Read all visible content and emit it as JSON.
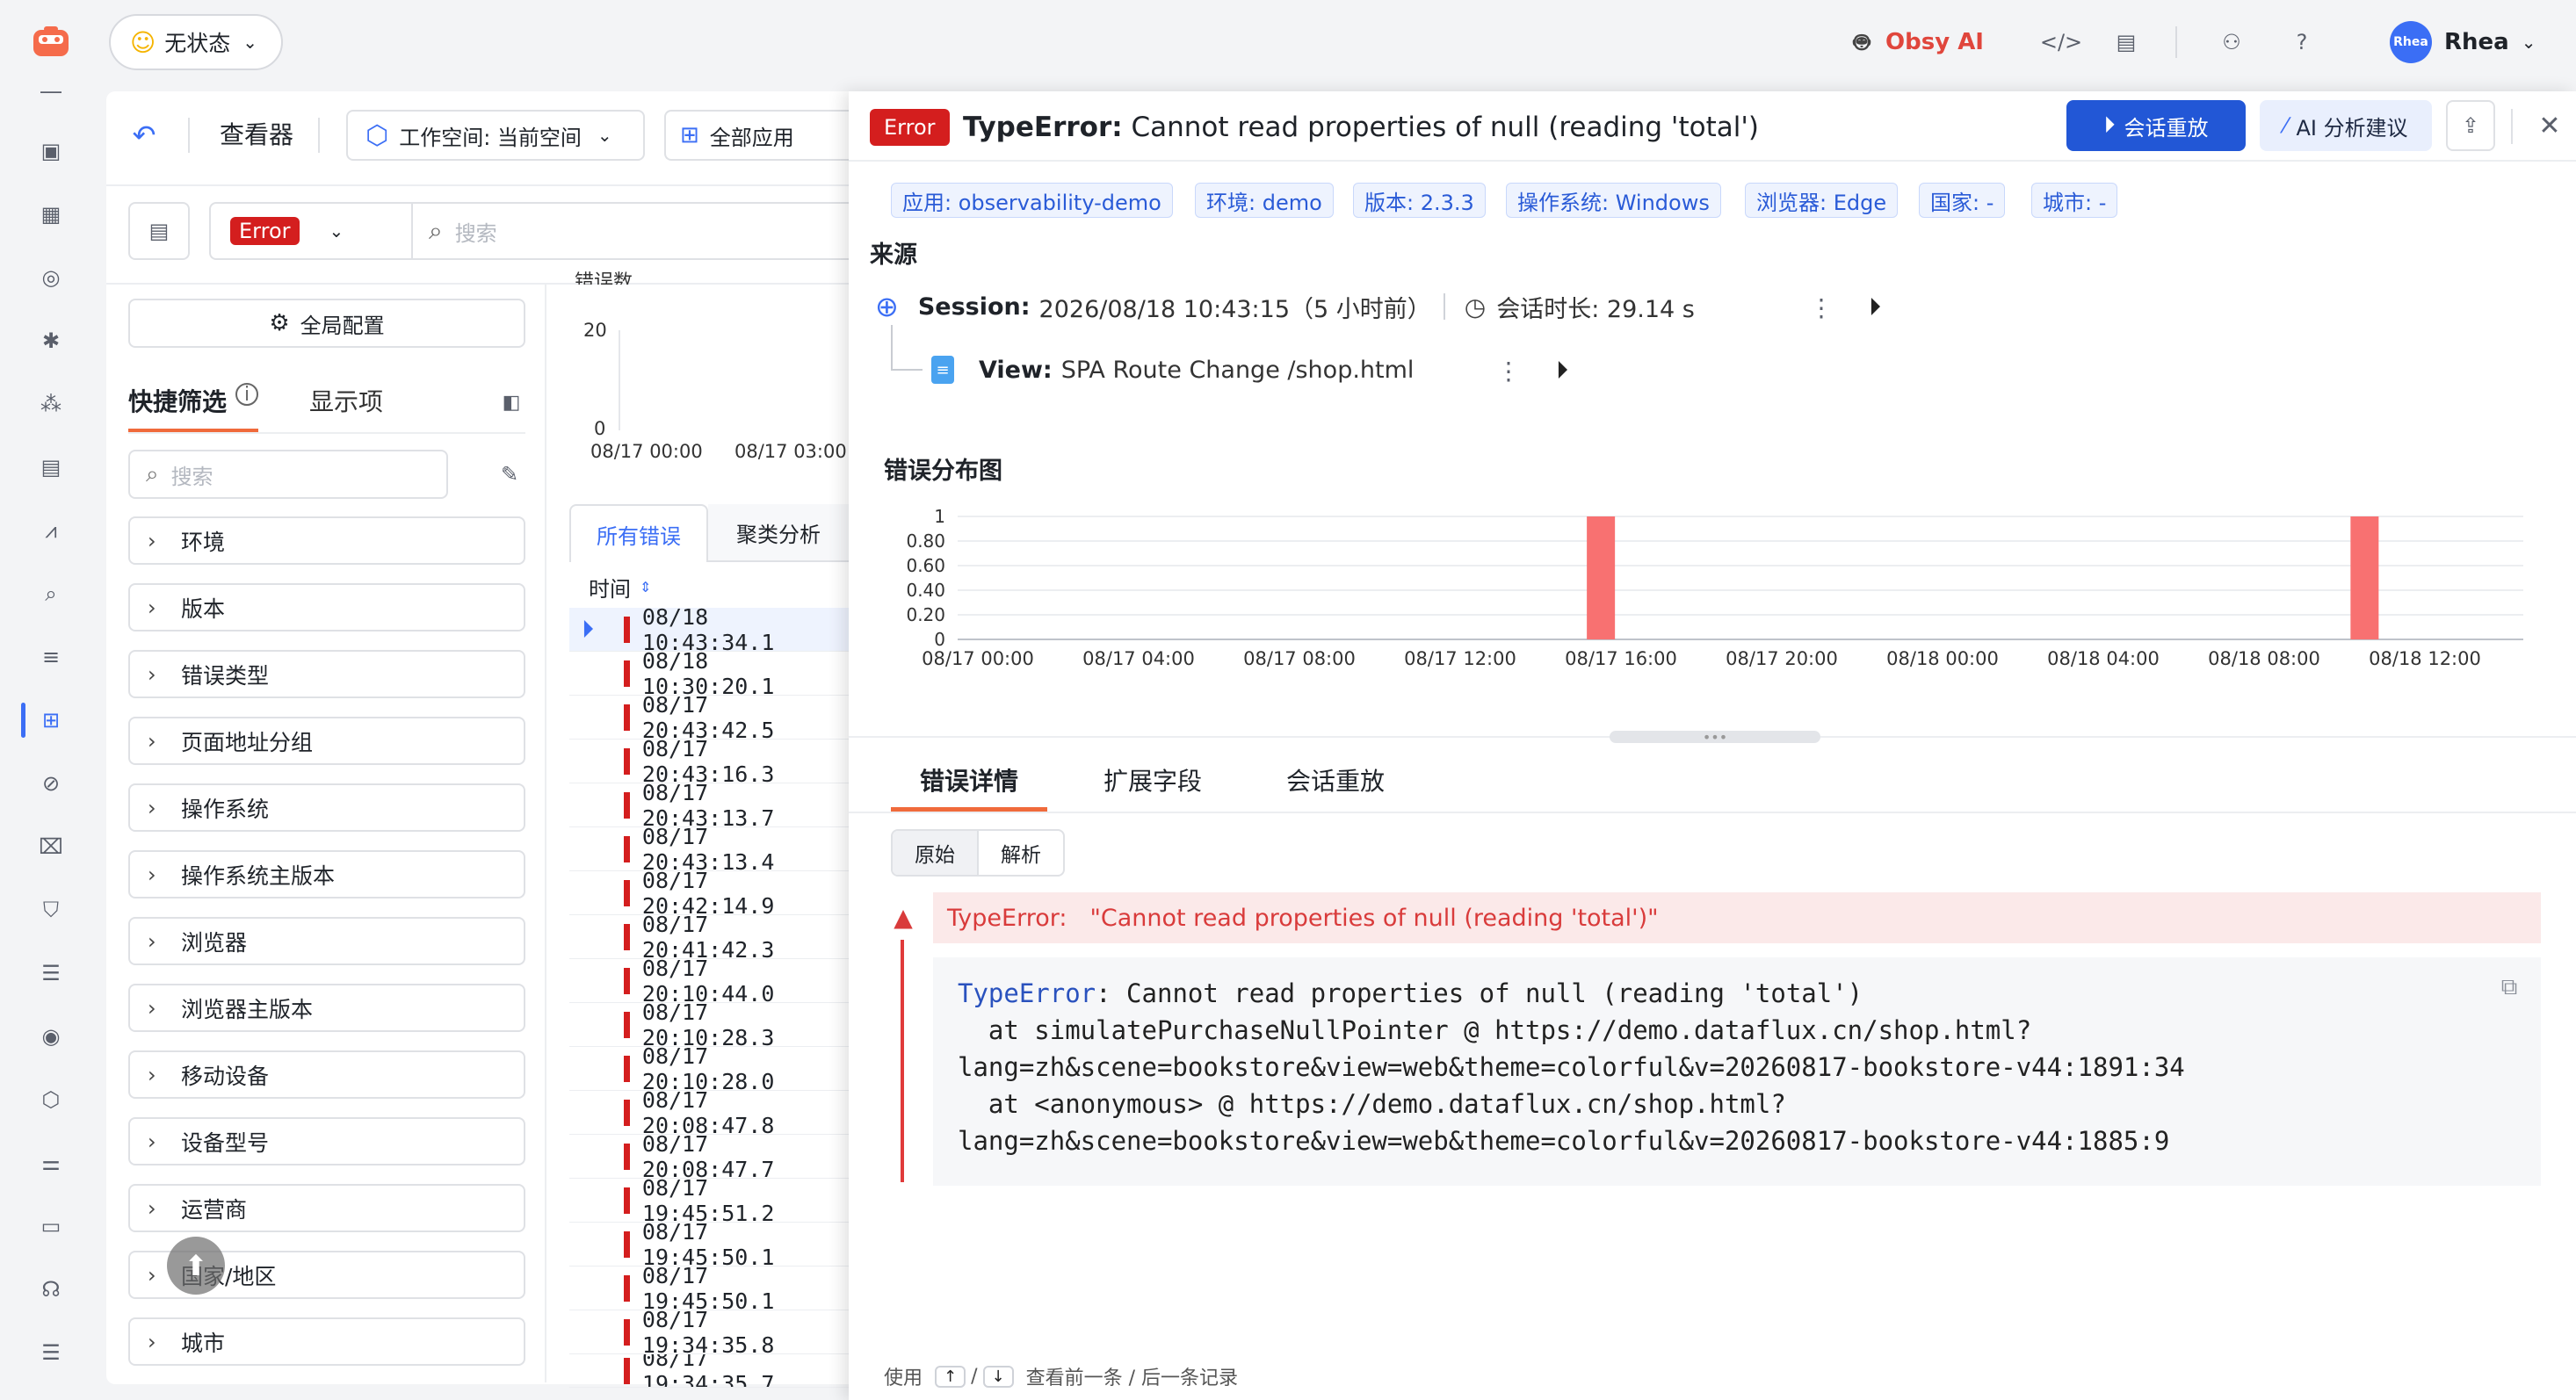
{
  "app": {
    "status_label": "无状态",
    "obsy_ai": "Obsy AI",
    "user_name": "Rhea",
    "avatar_text": "Rhea"
  },
  "toolbar": {
    "viewer_title": "查看器",
    "workspace_label": "工作空间: 当前空间",
    "apps_label": "全部应用",
    "filter_value": "Error",
    "search_placeholder": "搜索"
  },
  "sidebar": {
    "global_config": "全局配置",
    "tab_quick_filter": "快捷筛选",
    "tab_display": "显示项",
    "search_placeholder": "搜索",
    "filters": [
      "环境",
      "版本",
      "错误类型",
      "页面地址分组",
      "操作系统",
      "操作系统主版本",
      "浏览器",
      "浏览器主版本",
      "移动设备",
      "设备型号",
      "运营商",
      "国家/地区",
      "城市"
    ]
  },
  "mini_chart": {
    "y_top": "20",
    "y_bottom": "0",
    "x_ticks": [
      "08/17 00:00",
      "08/17 03:00"
    ],
    "header_partial": "错误数"
  },
  "list": {
    "tab_all": "所有错误",
    "tab_cluster": "聚类分析",
    "col_time": "时间",
    "rows": [
      "08/18 10:43:34.1",
      "08/18 10:30:20.1",
      "08/17 20:43:42.5",
      "08/17 20:43:16.3",
      "08/17 20:43:13.7",
      "08/17 20:43:13.4",
      "08/17 20:42:14.9",
      "08/17 20:41:42.3",
      "08/17 20:10:44.0",
      "08/17 20:10:28.3",
      "08/17 20:10:28.0",
      "08/17 20:08:47.8",
      "08/17 20:08:47.7",
      "08/17 19:45:51.2",
      "08/17 19:45:50.1",
      "08/17 19:45:50.1",
      "08/17 19:34:35.8",
      "08/17 19:34:35.7"
    ]
  },
  "detail": {
    "badge": "Error",
    "title_type": "TypeError:",
    "title_msg": "Cannot read properties of null (reading 'total')",
    "btn_replay": "会话重放",
    "btn_ai": "AI 分析建议",
    "tags": [
      "应用: observability-demo",
      "环境: demo",
      "版本: 2.3.3",
      "操作系统: Windows",
      "浏览器: Edge",
      "国家: -",
      "城市: -"
    ],
    "source_title": "来源",
    "session_label": "Session:",
    "session_value": "2026/08/18 10:43:15（5 小时前）",
    "duration_label": "会话时长: 29.14 s",
    "view_label": "View:",
    "view_value": "SPA Route Change /shop.html",
    "dist_title": "错误分布图",
    "tab_detail": "错误详情",
    "tab_ext": "扩展字段",
    "tab_replay": "会话重放",
    "seg_raw": "原始",
    "seg_parse": "解析",
    "err_type": "TypeError:",
    "err_msg": "\"Cannot read properties of null (reading 'total')\"",
    "stack": [
      "TypeError: Cannot read properties of null (reading 'total')",
      "  at simulatePurchaseNullPointer @ https://demo.dataflux.cn/shop.html?",
      "lang=zh&scene=bookstore&view=web&theme=colorful&v=20260817-bookstore-v44:1891:34",
      "  at <anonymous> @ https://demo.dataflux.cn/shop.html?",
      "lang=zh&scene=bookstore&view=web&theme=colorful&v=20260817-bookstore-v44:1885:9"
    ],
    "footer_use": "使用",
    "footer_up": "↑",
    "footer_sep": "/",
    "footer_down": "↓",
    "footer_hint": "查看前一条 / 后一条记录"
  },
  "chart_data": {
    "type": "bar",
    "title": "错误分布图",
    "x_ticks": [
      "08/17 00:00",
      "08/17 04:00",
      "08/17 08:00",
      "08/17 12:00",
      "08/17 16:00",
      "08/17 20:00",
      "08/18 00:00",
      "08/18 04:00",
      "08/18 08:00",
      "08/18 12:00"
    ],
    "y_ticks": [
      "1",
      "0.80",
      "0.60",
      "0.40",
      "0.20",
      "0"
    ],
    "ylim": [
      0,
      1
    ],
    "xlim_hours": [
      0,
      40
    ],
    "series": [
      {
        "values": [
          {
            "x": "08/17 15:30",
            "y": 1
          },
          {
            "x": "08/18 10:30",
            "y": 1
          }
        ]
      }
    ],
    "grid": true,
    "bar_color": "#f87171"
  }
}
